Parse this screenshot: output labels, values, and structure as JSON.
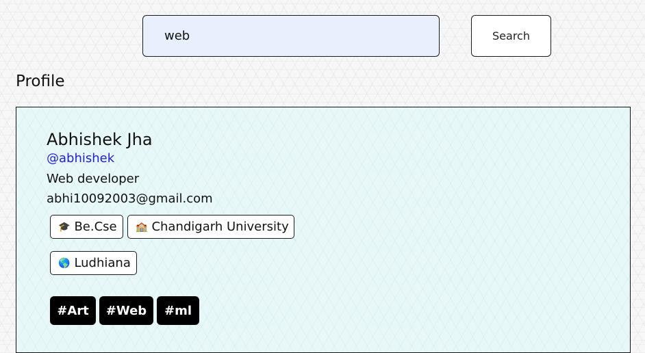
{
  "search": {
    "value": "web",
    "button_label": "Search"
  },
  "section": {
    "title": "Profile"
  },
  "profile": {
    "name": "Abhishek Jha",
    "handle": "@abhishek",
    "role": "Web developer",
    "email": "abhi10092003@gmail.com",
    "degree": {
      "emoji": "🎓",
      "label": "Be.Cse"
    },
    "university": {
      "emoji": "🏫",
      "label": "Chandigarh University"
    },
    "location": {
      "emoji": "🌎",
      "label": "Ludhiana"
    },
    "tags": [
      "#Art",
      "#Web",
      "#ml"
    ]
  },
  "colors": {
    "handle_link": "#1f1fd6",
    "search_input_bg": "#e8f0fe",
    "card_bg": "#e8f8f8",
    "tag_bg": "#000000",
    "tag_text": "#ffffff"
  },
  "icons": {
    "degree": "graduation-cap-icon",
    "university": "school-building-icon",
    "location": "globe-icon"
  }
}
